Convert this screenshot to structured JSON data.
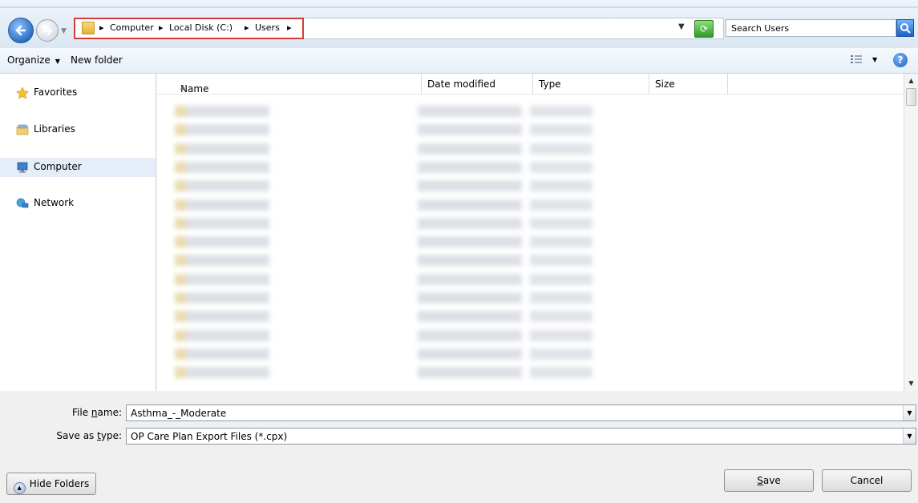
{
  "address_bar": {
    "crumbs": [
      "Computer",
      "Local Disk (C:)",
      "Users"
    ],
    "search_placeholder": "Search Users"
  },
  "toolbar": {
    "organize_label": "Organize",
    "new_folder_label": "New folder"
  },
  "nav_pane": {
    "items": [
      {
        "label": "Favorites",
        "icon": "star-icon"
      },
      {
        "label": "Libraries",
        "icon": "libraries-icon"
      },
      {
        "label": "Computer",
        "icon": "computer-icon",
        "selected": true
      },
      {
        "label": "Network",
        "icon": "network-icon"
      }
    ]
  },
  "file_list": {
    "columns": [
      "Name",
      "Date modified",
      "Type",
      "Size"
    ],
    "sort_column": "Name",
    "rows_blurred": true
  },
  "form": {
    "file_name_label_pre": "File ",
    "file_name_label_u": "n",
    "file_name_label_post": "ame:",
    "file_name_value": "Asthma_-_Moderate",
    "save_type_label_pre": "Save as ",
    "save_type_label_u": "t",
    "save_type_label_post": "ype:",
    "save_type_value": "OP Care Plan Export Files (*.cpx)"
  },
  "buttons": {
    "hide_folders": "Hide Folders",
    "save_u": "S",
    "save_rest": "ave",
    "cancel": "Cancel"
  },
  "colors": {
    "highlight_border": "#d93a3a",
    "selected_nav": "#e5eef8"
  }
}
